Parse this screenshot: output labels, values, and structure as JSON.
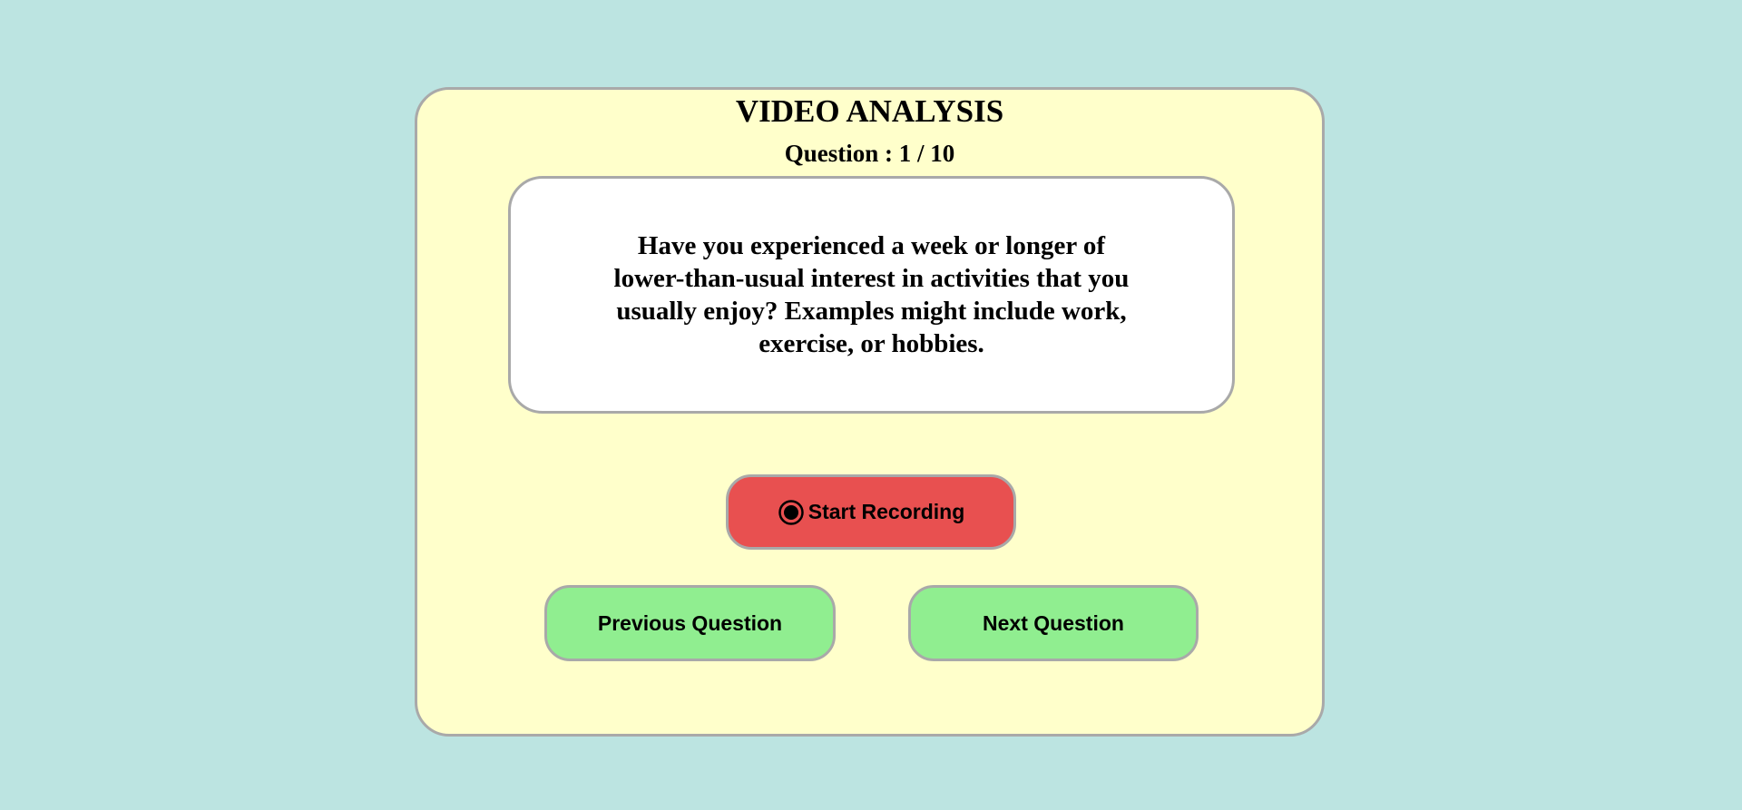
{
  "app": {
    "title": "VIDEO ANALYSIS"
  },
  "progress": {
    "label": "Question : 1 / 10",
    "current": 1,
    "total": 10
  },
  "question": {
    "text": "Have you experienced a week or longer of lower-than-usual interest in activities that you usually enjoy? Examples might include work, exercise, or hobbies."
  },
  "controls": {
    "record_label": "Start Recording",
    "record_icon": "record-icon",
    "previous_label": "Previous Question",
    "next_label": "Next Question"
  },
  "colors": {
    "background": "#bce4e1",
    "card": "#ffffcb",
    "record_button": "#e85050",
    "nav_button": "#90ee90",
    "border": "#a9a9a9"
  }
}
